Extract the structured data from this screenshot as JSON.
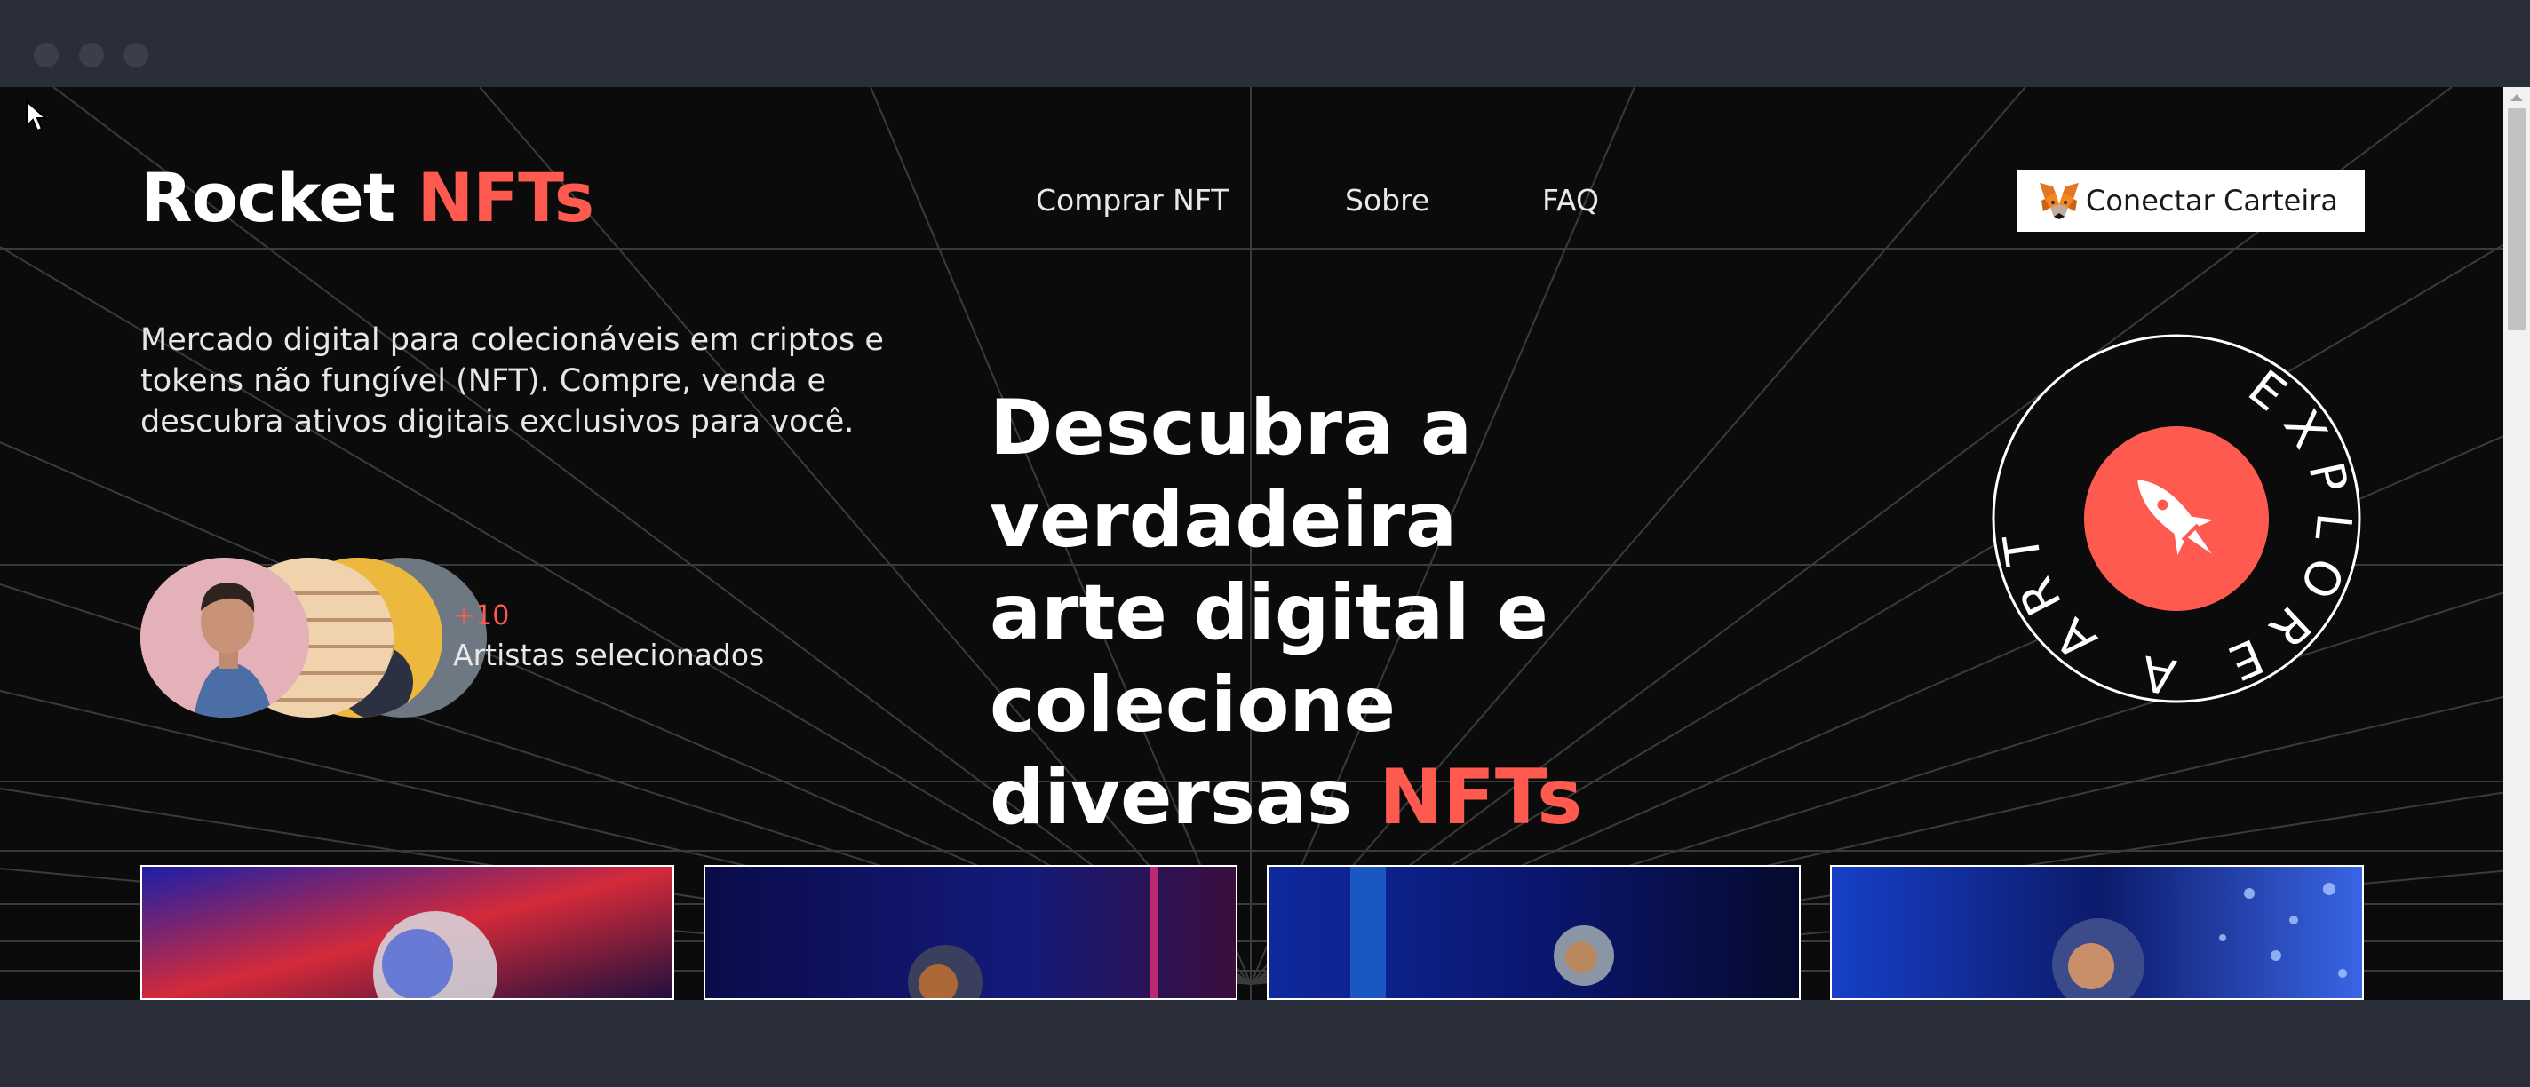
{
  "brand": {
    "name": "Rocket",
    "accent": "NFTs",
    "accent_color": "#ff5a4f"
  },
  "nav": {
    "items": [
      "Comprar NFT",
      "Sobre",
      "FAQ"
    ]
  },
  "wallet": {
    "label": "Conectar Carteira",
    "icon": "metamask-fox-icon"
  },
  "intro": {
    "text": "Mercado digital para colecionáveis em criptos e tokens não fungível (NFT). Compre, venda e descubra ativos digitais exclusivos para você."
  },
  "artists": {
    "count": "+10",
    "label": "Artistas selecionados"
  },
  "hero": {
    "line1": "Descubra a verdadeira",
    "line2": "arte digital e colecione",
    "line3_prefix": "diversas",
    "line3_accent": "NFTs"
  },
  "badge": {
    "text": "EXPLORE A ARTE",
    "icon": "rocket-icon",
    "color": "#ff5a4f"
  },
  "cards": [
    {
      "name": "astronaut-red-neon"
    },
    {
      "name": "astronaut-dark-blue"
    },
    {
      "name": "astronaut-blue-lights"
    },
    {
      "name": "astronaut-blue-particles"
    }
  ],
  "colors": {
    "background": "#0b0b0b",
    "accent": "#ff5a4f",
    "chrome": "#2a2e3a"
  }
}
